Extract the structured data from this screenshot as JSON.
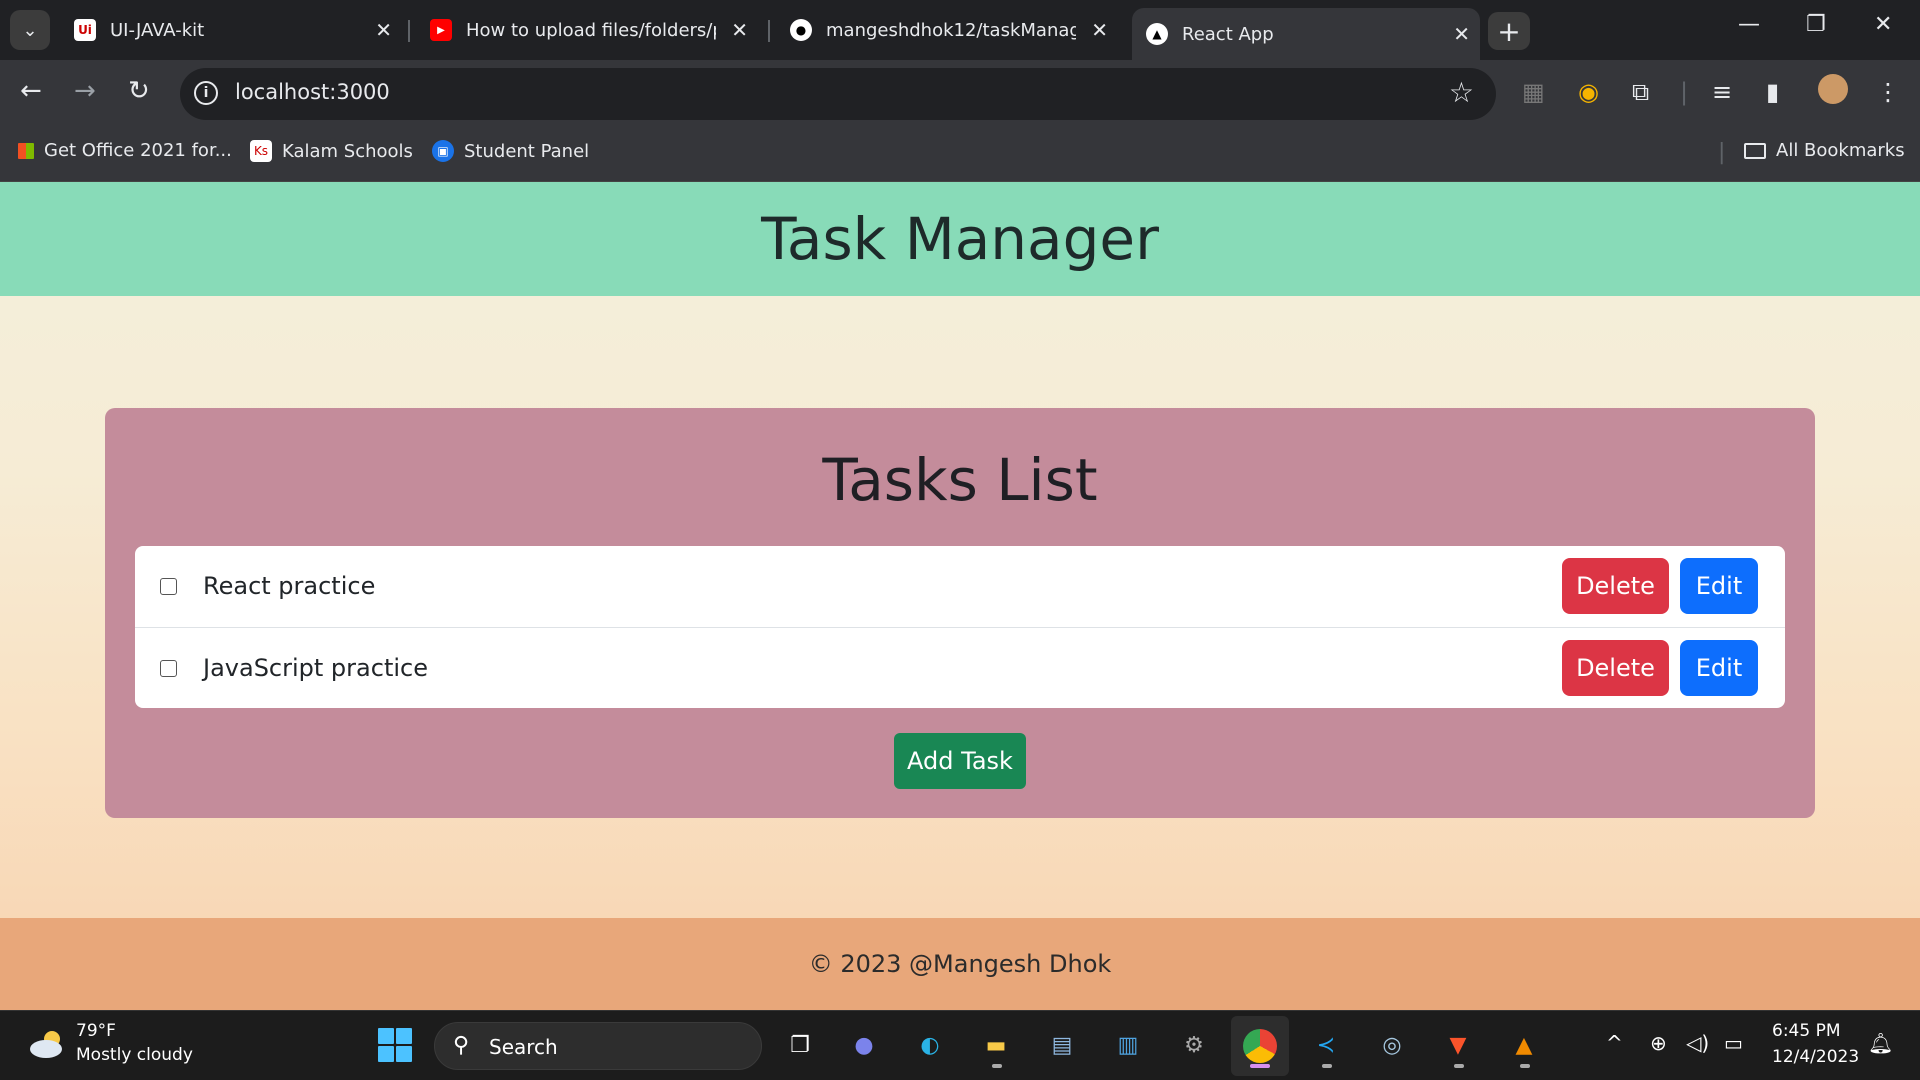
{
  "browser": {
    "tabs": [
      {
        "title": "UI-JAVA-kit",
        "favicon": "uikit-icon"
      },
      {
        "title": "How to upload files/folders/pr",
        "favicon": "youtube-icon"
      },
      {
        "title": "mangeshdhok12/taskManager",
        "favicon": "github-icon"
      },
      {
        "title": "React App",
        "favicon": "react-app-icon"
      }
    ],
    "url": "localhost:3000",
    "bookmarks": [
      {
        "label": "Get Office 2021 for..."
      },
      {
        "label": "Kalam Schools"
      },
      {
        "label": "Student Panel"
      }
    ],
    "all_bookmarks_label": "All Bookmarks"
  },
  "app": {
    "header_title": "Task Manager",
    "list_title": "Tasks List",
    "tasks": [
      {
        "text": "React practice",
        "delete_label": "Delete",
        "edit_label": "Edit"
      },
      {
        "text": "JavaScript practice",
        "delete_label": "Delete",
        "edit_label": "Edit"
      }
    ],
    "add_task_label": "Add Task",
    "footer_text": "© 2023 @Mangesh Dhok",
    "colors": {
      "header_bg": "#88dbb8",
      "card_bg": "#c48c9b",
      "delete": "#dc3545",
      "edit": "#0d6efd",
      "add": "#198754",
      "footer_bg": "#e8a77a"
    }
  },
  "taskbar": {
    "weather_temp": "79°F",
    "weather_condition": "Mostly cloudy",
    "search_label": "Search",
    "time": "6:45 PM",
    "date": "12/4/2023"
  }
}
